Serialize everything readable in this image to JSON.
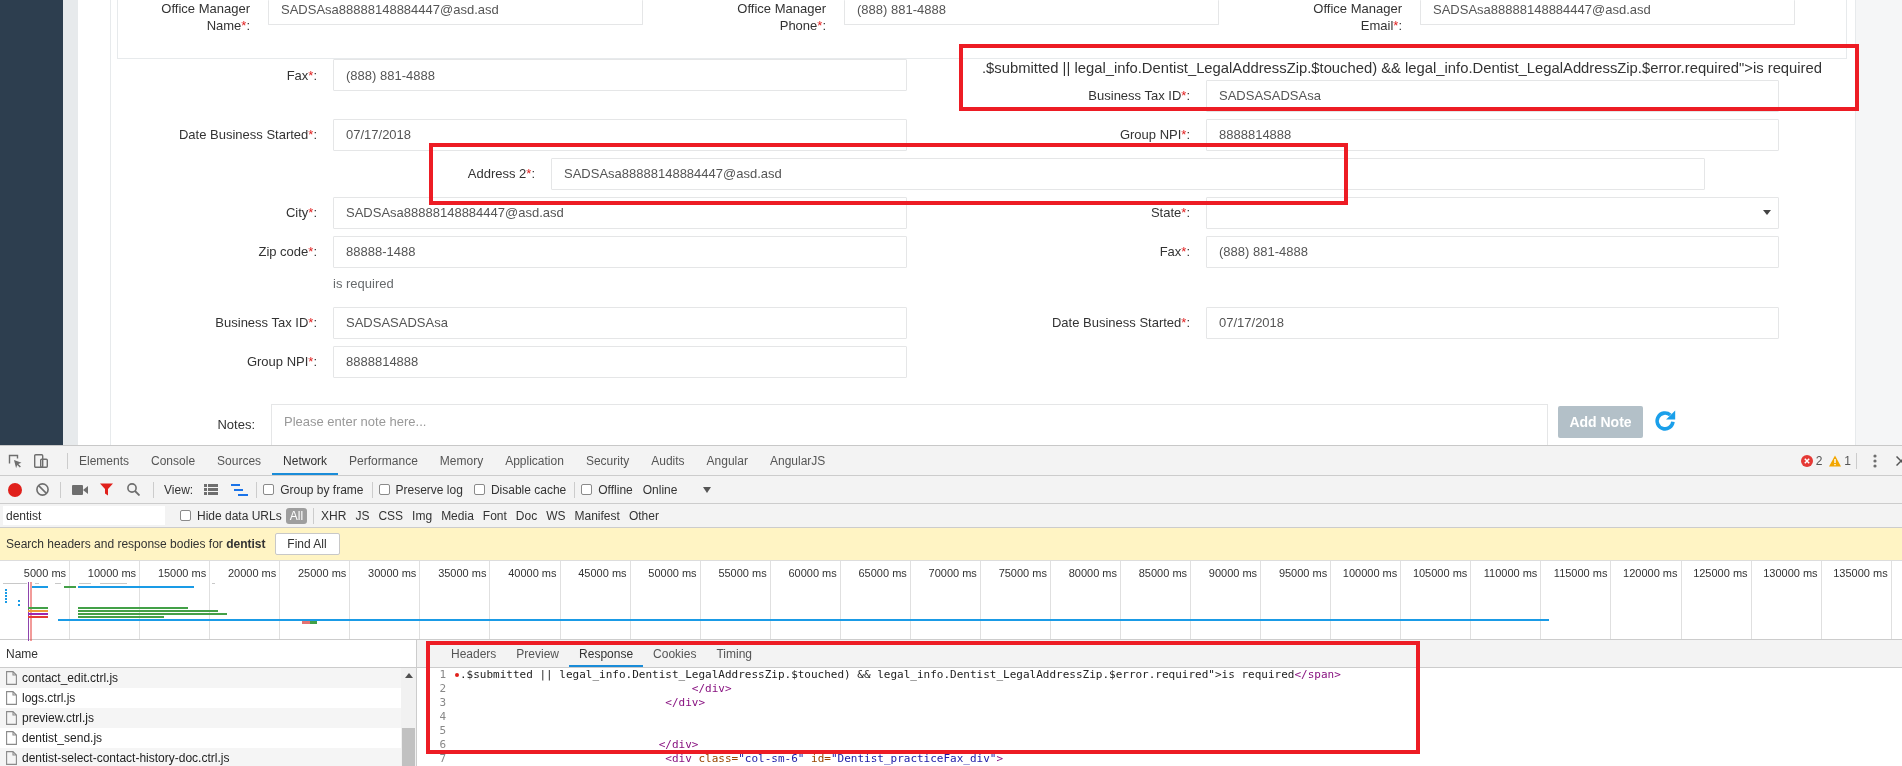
{
  "page": {
    "manager_fields": [
      {
        "label": "Office Manager Name",
        "asterisk": "*",
        "suffix": ":",
        "value": "SADSAsa88888148884447@asd.asd"
      },
      {
        "label": "Office Manager Phone",
        "asterisk": "*",
        "suffix": ":",
        "value": "(888) 881-4888"
      },
      {
        "label": "Office Manager Email",
        "asterisk": "*",
        "suffix": ":",
        "value": "SADSAsa88888148884447@asd.asd"
      }
    ],
    "rows": [
      {
        "kind": "pair",
        "left": {
          "kind": "input",
          "label": "Fax",
          "asterisk": "*",
          "suffix": ":",
          "value": "(888) 881-4888"
        },
        "right_text": ".$submitted || legal_info.Dentist_LegalAddressZip.$touched) && legal_info.Dentist_LegalAddressZip.$error.required\">is required",
        "right": {
          "kind": "input",
          "label": "Business Tax ID",
          "asterisk": "*",
          "suffix": ":",
          "value": "SADSASADSAsa"
        }
      },
      {
        "kind": "pair",
        "left": {
          "kind": "input",
          "label": "Date Business Started",
          "asterisk": "*",
          "suffix": ":",
          "value": "07/17/2018"
        },
        "right": {
          "kind": "input",
          "label": "Group NPI",
          "asterisk": "*",
          "suffix": ":",
          "value": "8888814888"
        }
      },
      {
        "kind": "wide",
        "field": {
          "kind": "input",
          "label": "Address 2",
          "asterisk": "*",
          "suffix": ":",
          "value": "SADSAsa88888148884447@asd.asd"
        }
      },
      {
        "kind": "pair",
        "left": {
          "kind": "input",
          "label": "City",
          "asterisk": "*",
          "suffix": ":",
          "value": "SADSAsa88888148884447@asd.asd"
        },
        "right": {
          "kind": "select",
          "label": "State",
          "asterisk": "*",
          "suffix": ":"
        }
      },
      {
        "kind": "pair",
        "left": {
          "kind": "input",
          "label": "Zip code",
          "asterisk": "*",
          "suffix": ":",
          "value": "88888-1488",
          "error": "is required"
        },
        "right": {
          "kind": "input",
          "label": "Fax",
          "asterisk": "*",
          "suffix": ":",
          "value": "(888) 881-4888"
        }
      },
      {
        "kind": "pair",
        "left": {
          "kind": "input",
          "label": "Business Tax ID",
          "asterisk": "*",
          "suffix": ":",
          "value": "SADSASADSAsa"
        },
        "right": {
          "kind": "input",
          "label": "Date Business Started",
          "asterisk": "*",
          "suffix": ":",
          "value": "07/17/2018"
        }
      },
      {
        "kind": "pair",
        "left": {
          "kind": "input",
          "label": "Group NPI",
          "asterisk": "*",
          "suffix": ":",
          "value": "8888814888"
        }
      }
    ],
    "notes": {
      "label": "Notes",
      "suffix": ":",
      "placeholder": "Please enter note here...",
      "button": {
        "label": "Add Note",
        "disabled": true
      }
    }
  },
  "devtools": {
    "tabs": [
      {
        "label": "Elements",
        "selected": false
      },
      {
        "label": "Console",
        "selected": false
      },
      {
        "label": "Sources",
        "selected": false
      },
      {
        "label": "Network",
        "selected": true
      },
      {
        "label": "Performance",
        "selected": false
      },
      {
        "label": "Memory",
        "selected": false
      },
      {
        "label": "Application",
        "selected": false
      },
      {
        "label": "Security",
        "selected": false
      },
      {
        "label": "Audits",
        "selected": false
      },
      {
        "label": "Angular",
        "selected": false
      },
      {
        "label": "AngularJS",
        "selected": false
      }
    ],
    "counts": {
      "errors": "2",
      "warnings": "1"
    },
    "toolbar": {
      "recording": true,
      "filter_active": true,
      "view_label": "View:",
      "large_rows": false,
      "overview": true,
      "options": [
        {
          "label": "Group by frame",
          "checked": false,
          "divider_before": true
        },
        {
          "label": "Preserve log",
          "checked": false,
          "divider_before": true
        },
        {
          "label": "Disable cache",
          "checked": false,
          "divider_before": false
        },
        {
          "label": "Offline",
          "checked": false,
          "divider_before": true
        }
      ],
      "throttling": "Online"
    },
    "filter": {
      "value": "dentist",
      "hide_data_urls": {
        "label": "Hide data URLs",
        "checked": false
      },
      "types": [
        {
          "label": "All",
          "selected": true,
          "divider_after": true
        },
        {
          "label": "XHR",
          "selected": false,
          "divider_after": false
        },
        {
          "label": "JS",
          "selected": false,
          "divider_after": false
        },
        {
          "label": "CSS",
          "selected": false,
          "divider_after": false
        },
        {
          "label": "Img",
          "selected": false,
          "divider_after": false
        },
        {
          "label": "Media",
          "selected": false,
          "divider_after": false
        },
        {
          "label": "Font",
          "selected": false,
          "divider_after": false
        },
        {
          "label": "Doc",
          "selected": false,
          "divider_after": false
        },
        {
          "label": "WS",
          "selected": false,
          "divider_after": false
        },
        {
          "label": "Manifest",
          "selected": false,
          "divider_after": false
        },
        {
          "label": "Other",
          "selected": false,
          "divider_after": false
        }
      ]
    },
    "search": {
      "text": "Search headers and response bodies for **dentist**",
      "button": "Find All"
    },
    "timeline": {
      "ticks": [
        "5000 ms",
        "10000 ms",
        "15000 ms",
        "20000 ms",
        "25000 ms",
        "30000 ms",
        "35000 ms",
        "40000 ms",
        "45000 ms",
        "50000 ms",
        "55000 ms",
        "60000 ms",
        "65000 ms",
        "70000 ms",
        "75000 ms",
        "80000 ms",
        "85000 ms",
        "90000 ms",
        "95000 ms",
        "100000 ms",
        "105000 ms",
        "110000 ms",
        "115000 ms",
        "120000 ms",
        "125000 ms",
        "130000 ms",
        "135000 ms"
      ]
    },
    "requests": {
      "header": "Name",
      "rows": [
        {
          "name": "contact_edit.ctrl.js"
        },
        {
          "name": "logs.ctrl.js"
        },
        {
          "name": "preview.ctrl.js"
        },
        {
          "name": "dentist_send.js"
        },
        {
          "name": "dentist-select-contact-history-doc.ctrl.js"
        }
      ]
    },
    "detail": {
      "tabs": [
        {
          "label": "Headers",
          "selected": false
        },
        {
          "label": "Preview",
          "selected": false
        },
        {
          "label": "Response",
          "selected": true
        },
        {
          "label": "Cookies",
          "selected": false
        },
        {
          "label": "Timing",
          "selected": false
        }
      ],
      "lines": [
        {
          "number": "1",
          "marked": true,
          "tokens": [
            {
              "kind": "text",
              "text": ".$submitted || legal_info.Dentist_LegalAddressZip.$touched) && legal_info.Dentist_LegalAddressZip.$error.required\">is required"
            },
            {
              "kind": "tag",
              "text": "</span>"
            }
          ]
        },
        {
          "number": "2",
          "marked": false,
          "tokens": [
            {
              "kind": "tag",
              "text": "                                   </div>"
            }
          ]
        },
        {
          "number": "3",
          "marked": false,
          "tokens": [
            {
              "kind": "tag",
              "text": "                               </div>"
            }
          ]
        },
        {
          "number": "4",
          "marked": false
        },
        {
          "number": "5",
          "marked": false
        },
        {
          "number": "6",
          "marked": false,
          "tokens": [
            {
              "kind": "tag",
              "text": "                              </div>"
            }
          ]
        },
        {
          "number": "7",
          "marked": false,
          "tokens": [
            {
              "kind": "tag",
              "text": "                               <div"
            },
            {
              "kind": "attr",
              "text": " class="
            },
            {
              "kind": "value",
              "text": "\"col-sm-6\""
            },
            {
              "kind": "attr",
              "text": " id="
            },
            {
              "kind": "value",
              "text": "\"Dentist_practiceFax_div\""
            },
            {
              "kind": "tag",
              "text": ">"
            }
          ]
        }
      ]
    }
  }
}
